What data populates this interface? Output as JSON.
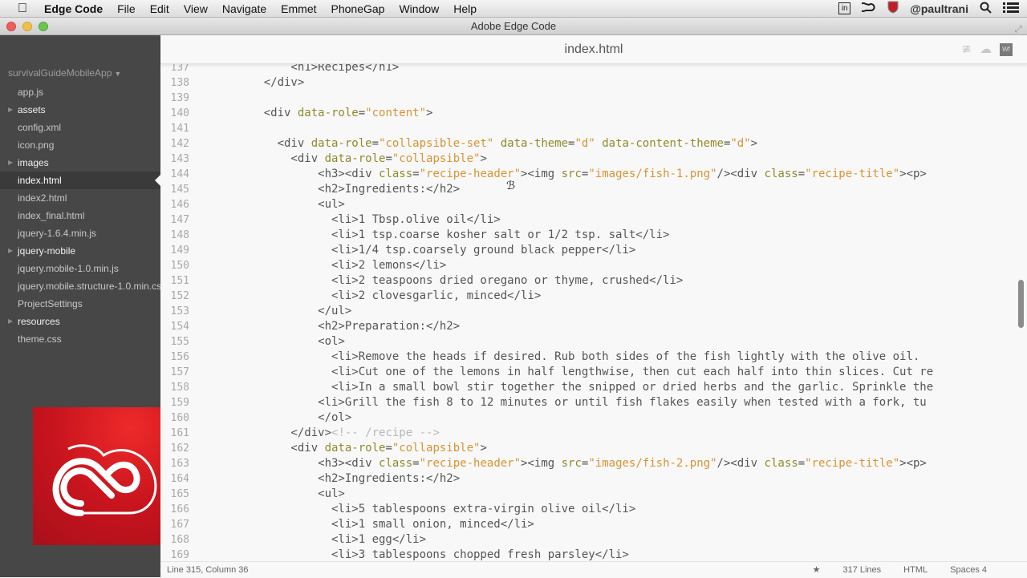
{
  "menubar": {
    "app_name": "Edge Code",
    "items": [
      "File",
      "Edit",
      "View",
      "Navigate",
      "Emmet",
      "PhoneGap",
      "Window",
      "Help"
    ],
    "status_icons": [
      "linkedin-icon",
      "creative-cloud-icon",
      "mcafee-shield-icon"
    ],
    "linkedin_label": "in",
    "user": "@paultrani"
  },
  "window": {
    "title": "Adobe Edge Code"
  },
  "sidebar": {
    "project": "survivalGuideMobileApp",
    "items": [
      {
        "label": "app.js",
        "type": "file"
      },
      {
        "label": "assets",
        "type": "folder"
      },
      {
        "label": "config.xml",
        "type": "file"
      },
      {
        "label": "icon.png",
        "type": "file"
      },
      {
        "label": "images",
        "type": "folder"
      },
      {
        "label": "index.html",
        "type": "file",
        "selected": true
      },
      {
        "label": "index2.html",
        "type": "file"
      },
      {
        "label": "index_final.html",
        "type": "file"
      },
      {
        "label": "jquery-1.6.4.min.js",
        "type": "file"
      },
      {
        "label": "jquery-mobile",
        "type": "folder"
      },
      {
        "label": "jquery.mobile-1.0.min.js",
        "type": "file"
      },
      {
        "label": "jquery.mobile.structure-1.0.min.css",
        "type": "file"
      },
      {
        "label": "ProjectSettings",
        "type": "file"
      },
      {
        "label": "resources",
        "type": "folder"
      },
      {
        "label": "theme.css",
        "type": "file"
      }
    ]
  },
  "editor": {
    "filename": "index.html",
    "header_icons": [
      "live-preview-icon",
      "extract-icon",
      "web-fonts-icon"
    ],
    "wf_label": "Wf",
    "lines": [
      {
        "n": "137",
        "segs": [
          [
            "tg",
            "        <h1>Recipes</h1>"
          ]
        ]
      },
      {
        "n": "138",
        "segs": [
          [
            "tg",
            "    </div>"
          ]
        ]
      },
      {
        "n": "139",
        "segs": []
      },
      {
        "n": "140",
        "segs": [
          [
            "tg",
            "    <div "
          ],
          [
            "at",
            "data-role"
          ],
          [
            "tg",
            "="
          ],
          [
            "st",
            "\"content\""
          ],
          [
            "tg",
            ">"
          ]
        ]
      },
      {
        "n": "141",
        "segs": []
      },
      {
        "n": "142",
        "segs": [
          [
            "tg",
            "      <div "
          ],
          [
            "at",
            "data-role"
          ],
          [
            "tg",
            "="
          ],
          [
            "st",
            "\"collapsible-set\""
          ],
          [
            "tg",
            " "
          ],
          [
            "at",
            "data-theme"
          ],
          [
            "tg",
            "="
          ],
          [
            "st",
            "\"d\""
          ],
          [
            "tg",
            " "
          ],
          [
            "at",
            "data-content-theme"
          ],
          [
            "tg",
            "="
          ],
          [
            "st",
            "\"d\""
          ],
          [
            "tg",
            ">"
          ]
        ]
      },
      {
        "n": "143",
        "segs": [
          [
            "tg",
            "        <div "
          ],
          [
            "at",
            "data-role"
          ],
          [
            "tg",
            "="
          ],
          [
            "st",
            "\"collapsible\""
          ],
          [
            "tg",
            ">"
          ]
        ]
      },
      {
        "n": "144",
        "segs": [
          [
            "tg",
            "            <h3><div "
          ],
          [
            "at",
            "class"
          ],
          [
            "tg",
            "="
          ],
          [
            "st",
            "\"recipe-header\""
          ],
          [
            "tg",
            "><img "
          ],
          [
            "at",
            "src"
          ],
          [
            "tg",
            "="
          ],
          [
            "st",
            "\"images/fish-1.png\""
          ],
          [
            "tg",
            "/><div "
          ],
          [
            "at",
            "class"
          ],
          [
            "tg",
            "="
          ],
          [
            "st",
            "\"recipe-title\""
          ],
          [
            "tg",
            "><p>"
          ]
        ]
      },
      {
        "n": "145",
        "segs": [
          [
            "tg",
            "            <h2>Ingredients:</h2>"
          ]
        ]
      },
      {
        "n": "146",
        "segs": [
          [
            "tg",
            "            <ul>"
          ]
        ]
      },
      {
        "n": "147",
        "segs": [
          [
            "tg",
            "              <li>1 Tbsp.olive oil</li>"
          ]
        ]
      },
      {
        "n": "148",
        "segs": [
          [
            "tg",
            "              <li>1 tsp.coarse kosher salt or 1/2 tsp. salt</li>"
          ]
        ]
      },
      {
        "n": "149",
        "segs": [
          [
            "tg",
            "              <li>1/4 tsp.coarsely ground black pepper</li>"
          ]
        ]
      },
      {
        "n": "150",
        "segs": [
          [
            "tg",
            "              <li>2 lemons</li>"
          ]
        ]
      },
      {
        "n": "151",
        "segs": [
          [
            "tg",
            "              <li>2 teaspoons dried oregano or thyme, crushed</li>"
          ]
        ]
      },
      {
        "n": "152",
        "segs": [
          [
            "tg",
            "              <li>2 clovesgarlic, minced</li>"
          ]
        ]
      },
      {
        "n": "153",
        "segs": [
          [
            "tg",
            "            </ul>"
          ]
        ]
      },
      {
        "n": "154",
        "segs": [
          [
            "tg",
            "            <h2>Preparation:</h2>"
          ]
        ]
      },
      {
        "n": "155",
        "segs": [
          [
            "tg",
            "            <ol>"
          ]
        ]
      },
      {
        "n": "156",
        "segs": [
          [
            "tg",
            "              <li>Remove the heads if desired. Rub both sides of the fish lightly with the olive oil. "
          ]
        ]
      },
      {
        "n": "157",
        "segs": [
          [
            "tg",
            "              <li>Cut one of the lemons in half lengthwise, then cut each half into thin slices. Cut re"
          ]
        ]
      },
      {
        "n": "158",
        "segs": [
          [
            "tg",
            "              <li>In a small bowl stir together the snipped or dried herbs and the garlic. Sprinkle the"
          ]
        ]
      },
      {
        "n": "159",
        "segs": [
          [
            "tg",
            "            <li>Grill the fish 8 to 12 minutes or until fish flakes easily when tested with a fork, tu"
          ]
        ]
      },
      {
        "n": "160",
        "segs": [
          [
            "tg",
            "            </ol>"
          ]
        ]
      },
      {
        "n": "161",
        "segs": [
          [
            "tg",
            "        </div>"
          ],
          [
            "cm",
            "<!-- /recipe -->"
          ]
        ]
      },
      {
        "n": "162",
        "segs": [
          [
            "tg",
            "        <div "
          ],
          [
            "at",
            "data-role"
          ],
          [
            "tg",
            "="
          ],
          [
            "st",
            "\"collapsible\""
          ],
          [
            "tg",
            ">"
          ]
        ]
      },
      {
        "n": "163",
        "segs": [
          [
            "tg",
            "            <h3><div "
          ],
          [
            "at",
            "class"
          ],
          [
            "tg",
            "="
          ],
          [
            "st",
            "\"recipe-header\""
          ],
          [
            "tg",
            "><img "
          ],
          [
            "at",
            "src"
          ],
          [
            "tg",
            "="
          ],
          [
            "st",
            "\"images/fish-2.png\""
          ],
          [
            "tg",
            "/><div "
          ],
          [
            "at",
            "class"
          ],
          [
            "tg",
            "="
          ],
          [
            "st",
            "\"recipe-title\""
          ],
          [
            "tg",
            "><p>"
          ]
        ]
      },
      {
        "n": "164",
        "segs": [
          [
            "tg",
            "            <h2>Ingredients:</h2>"
          ]
        ]
      },
      {
        "n": "165",
        "segs": [
          [
            "tg",
            "            <ul>"
          ]
        ]
      },
      {
        "n": "166",
        "segs": [
          [
            "tg",
            "              <li>5 tablespoons extra-virgin olive oil</li>"
          ]
        ]
      },
      {
        "n": "167",
        "segs": [
          [
            "tg",
            "              <li>1 small onion, minced</li>"
          ]
        ]
      },
      {
        "n": "168",
        "segs": [
          [
            "tg",
            "              <li>1 egg</li>"
          ]
        ]
      },
      {
        "n": "169",
        "segs": [
          [
            "tg",
            "              <li>3 tablespoons chopped fresh parsley</li>"
          ]
        ]
      }
    ]
  },
  "statusbar": {
    "position": "Line 315, Column 36",
    "line_count": "317 Lines",
    "language": "HTML",
    "indent": "Spaces 4"
  },
  "colors": {
    "sidebar_bg": "#474747",
    "editor_bg": "#f8f8f8",
    "attr": "#8f8a2a",
    "string": "#d89333",
    "cc_red": "#d41a22"
  }
}
